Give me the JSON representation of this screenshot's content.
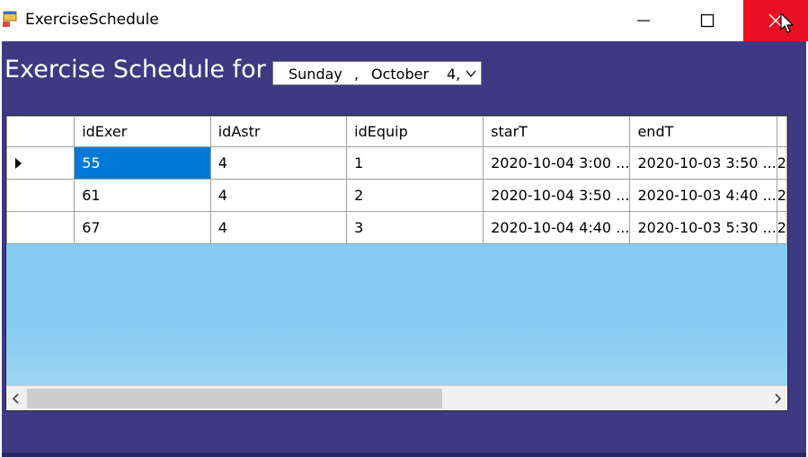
{
  "window": {
    "title": "ExerciseSchedule",
    "icon": "winforms-app-icon"
  },
  "heading": "Exercise Schedule for",
  "date_picker": {
    "day": "Sunday",
    "separator": ",",
    "month": "October",
    "date": "4,"
  },
  "grid": {
    "columns": [
      "idExer",
      "idAstr",
      "idEquip",
      "starT",
      "endT"
    ],
    "rows": [
      {
        "idExer": "55",
        "idAstr": "4",
        "idEquip": "1",
        "starT": "2020-10-04 3:00 ...",
        "endT": "2020-10-03 3:50 ...",
        "more": "2"
      },
      {
        "idExer": "61",
        "idAstr": "4",
        "idEquip": "2",
        "starT": "2020-10-04 3:50 ...",
        "endT": "2020-10-03 4:40 ...",
        "more": "2"
      },
      {
        "idExer": "67",
        "idAstr": "4",
        "idEquip": "3",
        "starT": "2020-10-04 4:40 ...",
        "endT": "2020-10-03 5:30 ...",
        "more": "2"
      }
    ],
    "current_row_indicator": "row-pointer-icon"
  },
  "colors": {
    "client_bg": "#3f3883",
    "grid_empty_bg": "#87cbf3",
    "selection": "#0078d7",
    "close_button": "#e81123"
  }
}
